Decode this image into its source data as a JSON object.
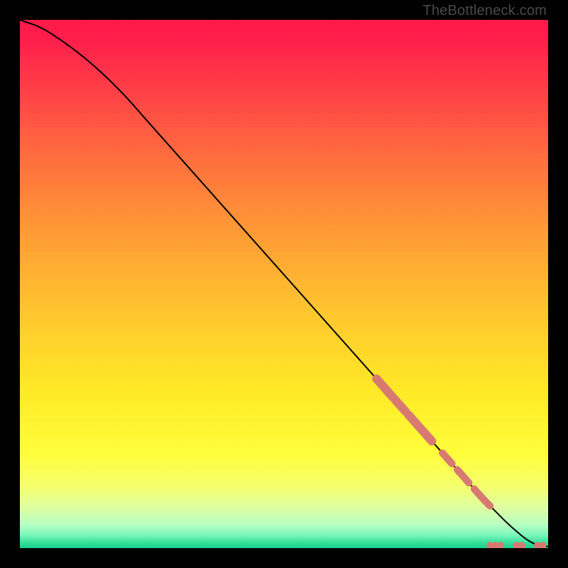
{
  "watermark": "TheBottleneck.com",
  "chart_data": {
    "type": "line",
    "title": "",
    "xlabel": "",
    "ylabel": "",
    "xlim": [
      0,
      100
    ],
    "ylim": [
      0,
      100
    ],
    "grid": false,
    "legend": false,
    "background_gradient": {
      "stops": [
        {
          "offset": 0.0,
          "color": "#ff1a4a"
        },
        {
          "offset": 0.04,
          "color": "#ff1f4b"
        },
        {
          "offset": 0.12,
          "color": "#ff3b48"
        },
        {
          "offset": 0.25,
          "color": "#ff6a3f"
        },
        {
          "offset": 0.4,
          "color": "#ff9a36"
        },
        {
          "offset": 0.55,
          "color": "#ffc52e"
        },
        {
          "offset": 0.7,
          "color": "#ffe927"
        },
        {
          "offset": 0.82,
          "color": "#fffd3a"
        },
        {
          "offset": 0.88,
          "color": "#f6ff6a"
        },
        {
          "offset": 0.92,
          "color": "#e2ff9e"
        },
        {
          "offset": 0.955,
          "color": "#b8ffc2"
        },
        {
          "offset": 0.975,
          "color": "#7cf7bb"
        },
        {
          "offset": 0.99,
          "color": "#34e09a"
        },
        {
          "offset": 1.0,
          "color": "#18cf8d"
        }
      ]
    },
    "series": [
      {
        "name": "curve",
        "kind": "line",
        "x": [
          0,
          4,
          8,
          12,
          16,
          20,
          24,
          28,
          32,
          36,
          40,
          44,
          48,
          52,
          56,
          60,
          64,
          68,
          72,
          76,
          80,
          84,
          88,
          90,
          92,
          94,
          96,
          98,
          100
        ],
        "y": [
          100,
          98.5,
          96,
          93,
          89.5,
          85.5,
          81,
          76.5,
          72,
          67.5,
          63,
          58.5,
          54,
          49.5,
          45,
          40.5,
          36,
          31.5,
          27,
          22.5,
          18,
          13.5,
          9,
          7,
          5,
          3.2,
          1.6,
          0.6,
          0.3
        ]
      },
      {
        "name": "highlight-upper",
        "kind": "scatter-band",
        "x_start": 67.5,
        "x_end": 78.0,
        "gap_ranges": [
          [
            70.6,
            71.0
          ],
          [
            73.0,
            73.6
          ]
        ],
        "width": 12
      },
      {
        "name": "highlight-lower",
        "kind": "scatter-band",
        "x_start": 80.0,
        "x_end": 89.0,
        "gap_ranges": [
          [
            81.8,
            82.8
          ],
          [
            85.0,
            86.0
          ]
        ],
        "width": 10
      },
      {
        "name": "flat-dots",
        "kind": "scatter",
        "points": [
          {
            "x": 89.0,
            "y": 0.5
          },
          {
            "x": 90.0,
            "y": 0.5
          },
          {
            "x": 91.0,
            "y": 0.5
          },
          {
            "x": 94.0,
            "y": 0.5
          },
          {
            "x": 95.0,
            "y": 0.5
          },
          {
            "x": 98.0,
            "y": 0.5
          },
          {
            "x": 99.0,
            "y": 0.5
          }
        ],
        "radius": 5
      }
    ],
    "colors": {
      "curve": "#000000",
      "marker": "#d87a72"
    }
  }
}
